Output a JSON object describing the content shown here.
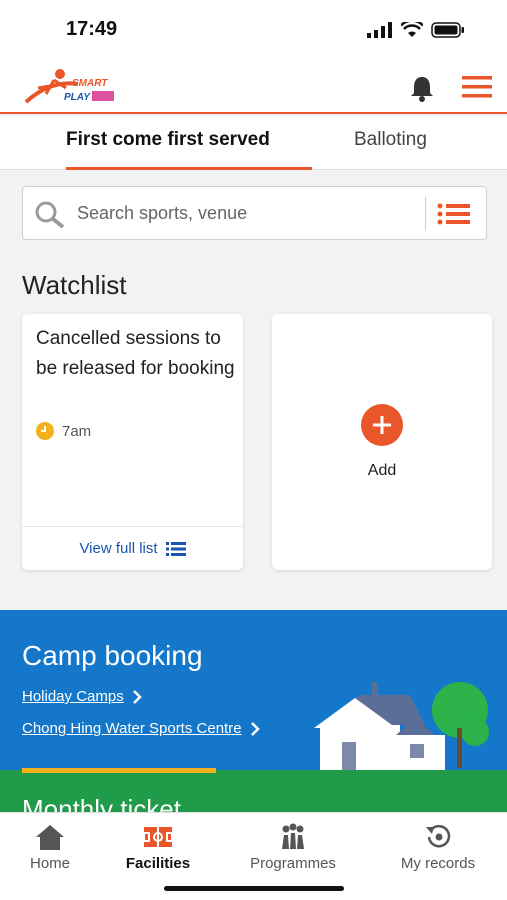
{
  "status": {
    "time": "17:49"
  },
  "header": {
    "logo_text_top": "SMART",
    "logo_text_bottom": "PLAY"
  },
  "tabs": [
    {
      "label": "First come first served"
    },
    {
      "label": "Balloting"
    }
  ],
  "search": {
    "placeholder": "Search sports, venue"
  },
  "watchlist": {
    "title": "Watchlist",
    "card": {
      "text": "Cancelled sessions to be released for booking",
      "time": "7am",
      "footer_label": "View full list"
    },
    "add_label": "Add"
  },
  "camp": {
    "title": "Camp booking",
    "links": [
      "Holiday Camps",
      "Chong Hing Water Sports Centre"
    ],
    "next_title": "Monthly ticket"
  },
  "nav": {
    "items": [
      {
        "label": "Home",
        "icon": "home-icon"
      },
      {
        "label": "Facilities",
        "icon": "facilities-icon"
      },
      {
        "label": "Programmes",
        "icon": "programmes-icon"
      },
      {
        "label": "My records",
        "icon": "records-icon"
      }
    ]
  },
  "colors": {
    "accent": "#e8562a",
    "camp_bg": "#1477c9",
    "link": "#1a55b0"
  }
}
